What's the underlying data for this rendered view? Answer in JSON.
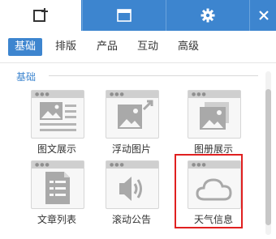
{
  "toolbar": {
    "tabs": [
      {
        "icon": "add-box-icon",
        "active": true
      },
      {
        "icon": "window-icon",
        "active": false
      },
      {
        "icon": "gear-icon",
        "active": false
      },
      {
        "icon": "close-icon",
        "active": false
      }
    ],
    "accent_color": "#3d85cf"
  },
  "categories": {
    "items": [
      "基础",
      "排版",
      "产品",
      "互动",
      "高级"
    ],
    "selected": "基础"
  },
  "section": {
    "title": "基础",
    "items": [
      {
        "label": "图文展示",
        "icon": "image-text-icon"
      },
      {
        "label": "浮动图片",
        "icon": "floating-image-icon"
      },
      {
        "label": "图册展示",
        "icon": "album-icon"
      },
      {
        "label": "文章列表",
        "icon": "article-list-icon"
      },
      {
        "label": "滚动公告",
        "icon": "speaker-icon"
      },
      {
        "label": "天气信息",
        "icon": "cloud-icon"
      }
    ],
    "highlighted": "天气信息"
  }
}
